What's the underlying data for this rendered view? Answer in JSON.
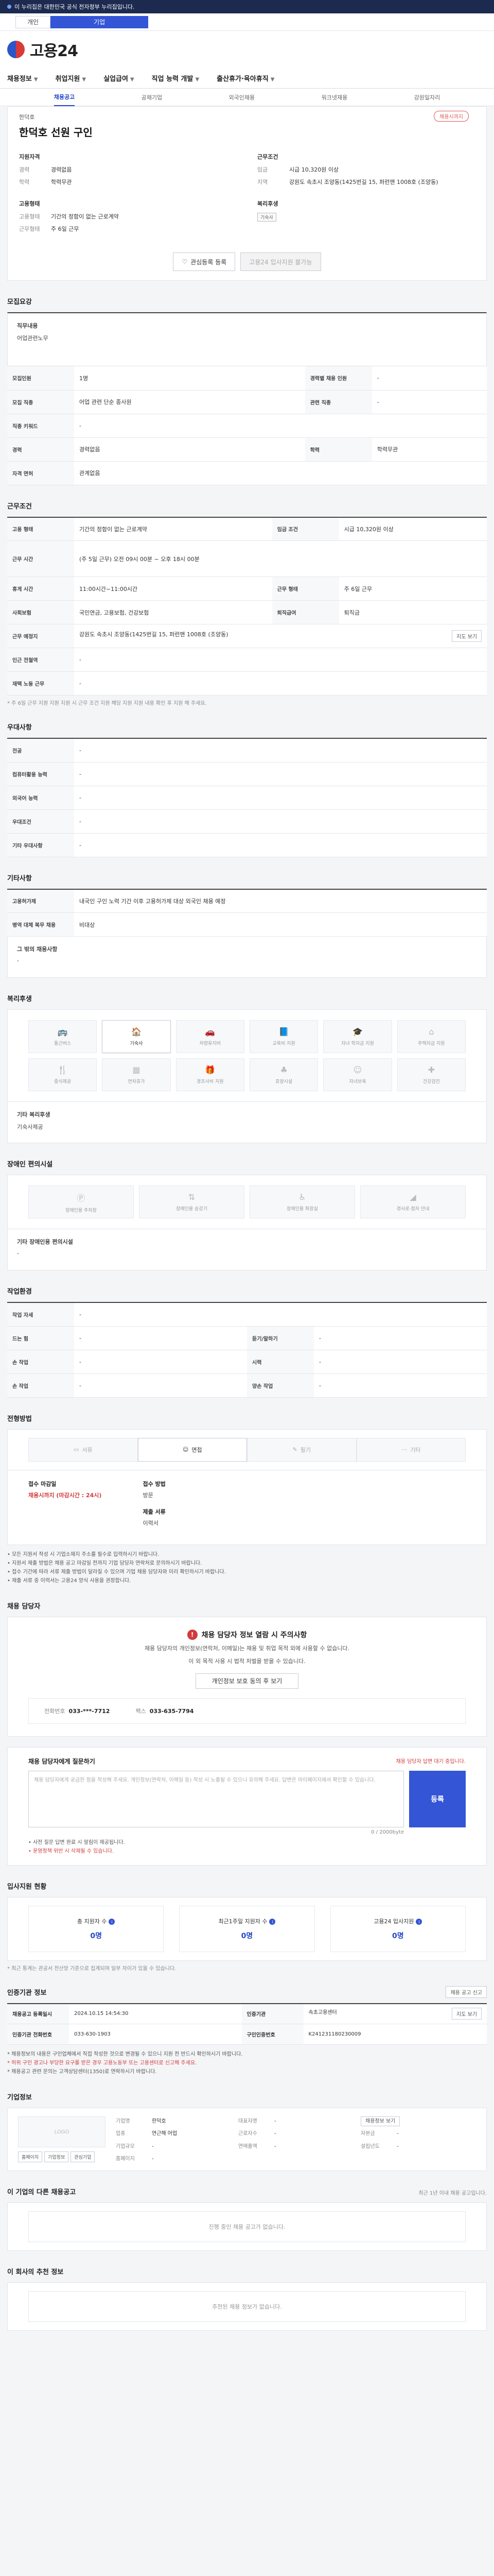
{
  "topbar": {
    "text": "이 누리집은 대한민국 공식 전자정부 누리집입니다."
  },
  "gov_tabs": [
    "개인",
    "기업"
  ],
  "logo": {
    "text": "고용24"
  },
  "gnb": [
    {
      "label": "채용정보"
    },
    {
      "label": "취업지원"
    },
    {
      "label": "실업급여"
    },
    {
      "label": "직업 능력 개발"
    },
    {
      "label": "출산휴가·육아휴직"
    }
  ],
  "subnav": [
    "채용공고",
    "공채기업",
    "외국인채용",
    "워크넷재용",
    "강원일자리"
  ],
  "header": {
    "company": "한덕호",
    "title": "한덕호 선원 구인",
    "badge": "채용시까지"
  },
  "summary": {
    "left": {
      "title": "지원자격",
      "rows": [
        {
          "k": "경력",
          "v": "경력없음"
        },
        {
          "k": "학력",
          "v": "학력무관"
        }
      ]
    },
    "left2": {
      "title": "고용형태",
      "rows": [
        {
          "k": "고용형태",
          "v": "기간의 정함이 없는 근로계약"
        },
        {
          "k": "근무형태",
          "v": "주 6일 근무"
        }
      ]
    },
    "right": {
      "title": "근무조건",
      "rows": [
        {
          "k": "임금",
          "v": "시급 10,320원 이상"
        },
        {
          "k": "지역",
          "v": "강원도 속초시 조양동(1425번길 15, 퍼런맨 1008호 (조양동)"
        }
      ]
    },
    "right2": {
      "title": "복리후생",
      "chip": "기숙사"
    }
  },
  "buttons": {
    "interest": "관심등록 등록",
    "apply": "고용24 입사지원 불가능"
  },
  "recruit": {
    "section": "모집요강",
    "job_title_label": "직무내용",
    "job_title_value": "어업관련노무",
    "rows": [
      {
        "k": "모집인원",
        "v": "1명",
        "k2": "경력별 채용 인원",
        "v2": "-"
      },
      {
        "k": "모집 직종",
        "v": "어업 관련 단순 종사원",
        "k2": "관련 직종",
        "v2": "-"
      },
      {
        "k": "직종 키워드",
        "v": "-",
        "k2": "",
        "v2": ""
      },
      {
        "k": "경력",
        "v": "경력없음",
        "k2": "학력",
        "v2": "학력무관"
      },
      {
        "k": "자격 면허",
        "v": "관계없음",
        "k2": "",
        "v2": ""
      }
    ]
  },
  "condition": {
    "section": "근무조건",
    "rows": [
      {
        "k": "고용 형태",
        "v": "기간의 정함이 없는 근로계약",
        "k2": "임금 조건",
        "v2": "시급 10,320원 이상"
      },
      {
        "k": "근무 시간",
        "v": "(주 5일 근무) 오전 09시 00분 ~ 오후 18시 00분",
        "k2": "",
        "v2": ""
      },
      {
        "k": "휴게 시간",
        "v": "11:00시간~11:00시간",
        "k2": "근무 형태",
        "v2": "주 6일 근무"
      },
      {
        "k": "사회보험",
        "v": "국민연금, 고용보험, 건강보험",
        "k2": "퇴직급여",
        "v2": "퇴직금"
      },
      {
        "k": "근무 예정지",
        "v": "강원도 속초시 조양동(1425번길 15, 퍼런맨 1008호 (조양동)",
        "k2": "",
        "v2": ""
      },
      {
        "k": "인근 전철역",
        "v": "-",
        "k2": "",
        "v2": ""
      },
      {
        "k": "재택 노동 근무",
        "v": "-",
        "k2": "",
        "v2": ""
      }
    ],
    "map_btn": "지도 보기",
    "note": "* 주 6일 근무 지원 지원 지원 시 근무 조건 지원 해당 지원 지원 내용 확인 후 지원 해 주세요."
  },
  "preference": {
    "section": "우대사항",
    "rows": [
      {
        "k": "전공",
        "v": "-"
      },
      {
        "k": "컴퓨터활용 능력",
        "v": "-"
      },
      {
        "k": "외국어 능력",
        "v": "-"
      },
      {
        "k": "우대조건",
        "v": "-"
      },
      {
        "k": "기타 우대사항",
        "v": "-"
      }
    ]
  },
  "other": {
    "section": "기타사항",
    "rows": [
      {
        "k": "고용허가제",
        "v": "내국인 구인 노력 기간 이후 고용허가제 대상 외국인 채용 예정"
      },
      {
        "k": "병역 대체 복무 채용",
        "v": "비대상"
      }
    ],
    "extra_label": "그 밖의 채용사항",
    "extra_value": "-"
  },
  "welfare": {
    "section": "복리후생",
    "items": [
      {
        "label": "통근버스",
        "icon": "bus-icon",
        "on": false
      },
      {
        "label": "기숙사",
        "icon": "dormitory-icon",
        "on": true
      },
      {
        "label": "차량유지비",
        "icon": "car-icon",
        "on": false
      },
      {
        "label": "교육비 지원",
        "icon": "book-icon",
        "on": false
      },
      {
        "label": "자녀 학자금 지원",
        "icon": "graduation-icon",
        "on": false
      },
      {
        "label": "주택자금 지원",
        "icon": "house-icon",
        "on": false
      },
      {
        "label": "중식제공",
        "icon": "meal-icon",
        "on": false
      },
      {
        "label": "연차휴가",
        "icon": "calendar-icon",
        "on": false
      },
      {
        "label": "경조사비 지원",
        "icon": "gift-icon",
        "on": false
      },
      {
        "label": "휴양시설",
        "icon": "tree-icon",
        "on": false
      },
      {
        "label": "자녀보육",
        "icon": "baby-icon",
        "on": false
      },
      {
        "label": "건강검진",
        "icon": "health-icon",
        "on": false
      }
    ],
    "extra_label": "기타 복리후생",
    "extra_value": "기숙사제공"
  },
  "disability": {
    "section": "장애인 편의시설",
    "items": [
      {
        "label": "장애인용 주차장",
        "icon": "parking-icon"
      },
      {
        "label": "장애인용 승강기",
        "icon": "elevator-icon"
      },
      {
        "label": "장애인용 화장실",
        "icon": "toilet-icon"
      },
      {
        "label": "경사로·점자 안내",
        "icon": "ramp-icon"
      }
    ],
    "extra_label": "기타 장애인용 편의시설",
    "extra_value": "-"
  },
  "environment": {
    "section": "작업환경",
    "rows": [
      {
        "k": "작업 자세",
        "v": "-",
        "k2": "",
        "v2": ""
      },
      {
        "k": "드는 힘",
        "v": "-",
        "k2": "듣기/말하기",
        "v2": "-"
      },
      {
        "k": "손 작업",
        "v": "-",
        "k2": "시력",
        "v2": "-"
      },
      {
        "k": "손 작업",
        "v": "-",
        "k2": "양손 작업",
        "v2": "-"
      }
    ]
  },
  "process": {
    "section": "전형방법",
    "steps": [
      {
        "label": "서류",
        "on": false
      },
      {
        "label": "면접",
        "on": true
      },
      {
        "label": "필기",
        "on": false
      },
      {
        "label": "기타",
        "on": false
      }
    ],
    "c1_h": "접수 마감일",
    "c1_v": "채용시까지 (마감시간 : 24시)",
    "c1b_h": "접수 방법",
    "c1b_v": "방문",
    "c2_h": "제출 서류",
    "c2_v": "이력서",
    "bullets": [
      "• 모든 지원서 작성 시 기업소재지 주소를 필수로 입력하시기 바랍니다.",
      "• 지원서 제출 방법은 채용 공고 마감일 전까지 기업 담당자 연락처로 문의하시기 바랍니다.",
      "• 접수 기간에 따라 서류 제출 방법이 달라질 수 있으며 기업 채용 담당자와 미리 확인하시기 바랍니다.",
      "• 제출 서류 중 이력서는 고용24 양식 사용을 권장합니다."
    ]
  },
  "contact": {
    "section": "채용 담당자",
    "warn": "채용 담당자 정보 열람 시 주의사항",
    "p1": "채용 담당자의 개인정보(연락처, 이메일)는 채용 및 취업 목적 외에 사용할 수 없습니다.",
    "p2": "이 외 목적 사용 시 법적 처벌을 받을 수 있습니다.",
    "btn": "개인정보 보호 동의 후 보기",
    "tel_k": "전화번호",
    "tel_v": "033-***-7712",
    "fax_k": "팩스",
    "fax_v": "033-635-7794"
  },
  "qa": {
    "title": "채용 담당자에게 질문하기",
    "right": "채용 담당자 답변 대기 중입니다.",
    "placeholder": "채용 담당자에게 궁금한 점을 작성해 주세요. 개인정보(연락처, 이메일 등) 작성 시 노출될 수 있으니 유의해 주세요. 답변은 마이페이지에서 확인할 수 있습니다.",
    "submit": "등록",
    "count": "0 / 2000byte",
    "notes": [
      "• 사전 질문 답변 완료 시 알림이 제공됩니다.",
      "• 운영정책 위반 시 삭제될 수 있습니다."
    ]
  },
  "stats": {
    "section": "입사지원 현황",
    "items": [
      {
        "l": "총 지원자 수",
        "n": "0명"
      },
      {
        "l": "최근1주일 지원자 수",
        "n": "0명"
      },
      {
        "l": "고용24 입사지원",
        "n": "0명"
      }
    ],
    "note": "* 최근 통계는 관공서 전산망 기준으로 집계되며 일부 차이가 있을 수 있습니다."
  },
  "registry": {
    "section": "인증기관 정보",
    "btn": "채용 공고 신고",
    "rows": [
      {
        "k": "채용공고 등록일시",
        "v": "2024.10.15 14:54:30",
        "k2": "인증기관",
        "v2": "속초고용센터"
      },
      {
        "k": "인증기관 전화번호",
        "v": "033-630-1903",
        "k2": "구인인증번호",
        "v2": "K241231180230009"
      }
    ],
    "map_btn": "지도 보기",
    "notes": [
      "* 채용정보의 내용은 구인업체에서 직접 작성한 것으로 변경될 수 있으니 지원 전 반드시 확인하시기 바랍니다.",
      "* 허위 구인 광고나 부당한 요구를 받은 경우 고용노동부 또는 고용센터로 신고해 주세요.",
      "* 채용공고 관련 문의는 고객상담센터(1350)로 연락하시기 바랍니다."
    ]
  },
  "company_info": {
    "section": "기업정보",
    "logo": "LOGO",
    "btns": [
      "홈페이지",
      "기업정보",
      "관심기업"
    ],
    "rows": [
      {
        "k": "기업명",
        "v": "한덕호"
      },
      {
        "k": "업종",
        "v": "연근해 어업"
      },
      {
        "k": "기업규모",
        "v": "-"
      },
      {
        "k": "대표자명",
        "v": "-"
      },
      {
        "k": "근로자수",
        "v": "-"
      },
      {
        "k": "연매출액",
        "v": "-"
      },
      {
        "k": "설립년도",
        "v": "-"
      },
      {
        "k": "자본금",
        "v": "-"
      },
      {
        "k": "홈페이지",
        "v": "-"
      }
    ],
    "more": "채용정보 보기"
  },
  "history": {
    "section": "이 기업의 다른 채용공고",
    "right": "최근 1년 이내 채용 공고입니다.",
    "empty": "진행 중인 채용 공고가 없습니다."
  },
  "recommend": {
    "section": "이 회사의 추천 정보",
    "empty": "추천된 채용 정보가 없습니다."
  }
}
